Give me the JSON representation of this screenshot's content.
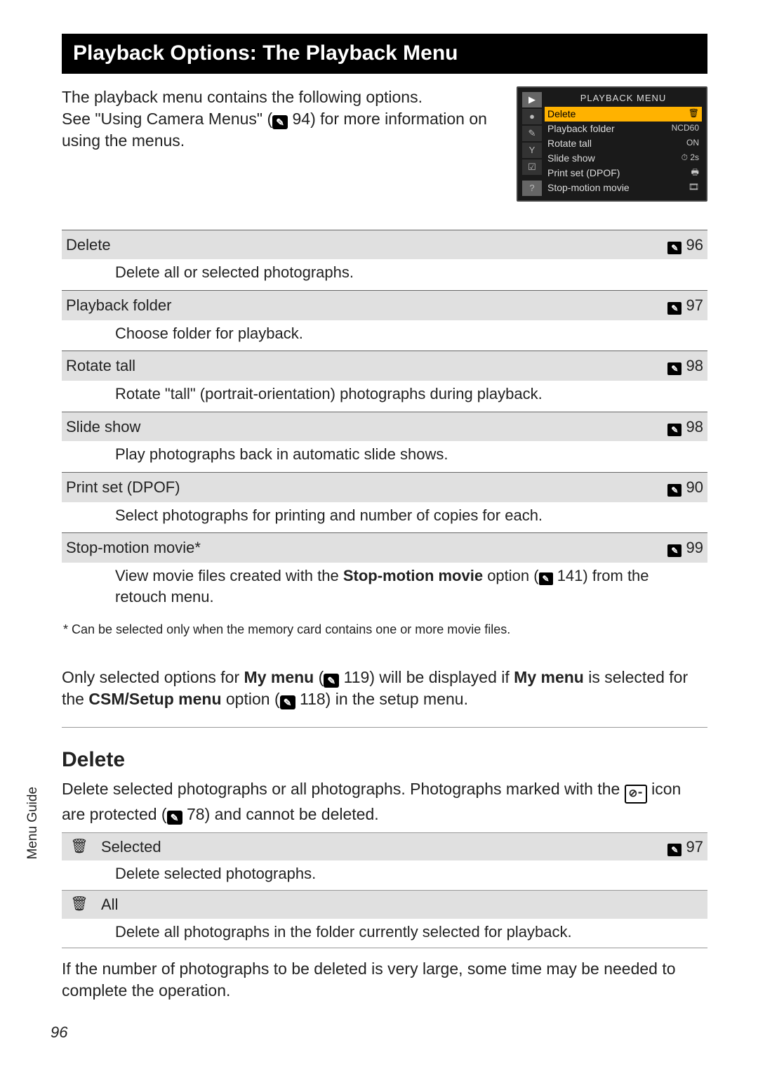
{
  "titleBar": "Playback Options: The Playback Menu",
  "intro": {
    "line1": "The playback menu contains the following options.",
    "line2a": "See \"Using Camera Menus\" (",
    "line2_ref": " 94",
    "line2b": ") for more information on using the menus."
  },
  "lcd": {
    "title": "PLAYBACK MENU",
    "items": [
      {
        "label": "Delete",
        "value": "🗑",
        "hl": true
      },
      {
        "label": "Playback folder",
        "value": "NCD60"
      },
      {
        "label": "Rotate tall",
        "value": "ON"
      },
      {
        "label": "Slide show",
        "value": "⏱ 2s"
      },
      {
        "label": "Print set (DPOF)",
        "value": "🖶"
      },
      {
        "label": "Stop-motion movie",
        "value": "🎞"
      }
    ],
    "tabs": [
      "▶",
      "●",
      "✎",
      "Y",
      "☑"
    ],
    "help": "?"
  },
  "options": [
    {
      "name": "Delete",
      "ref": "96",
      "desc": "Delete all or selected photographs."
    },
    {
      "name": "Playback folder",
      "ref": "97",
      "desc": "Choose folder for playback."
    },
    {
      "name": "Rotate tall",
      "ref": "98",
      "desc": "Rotate \"tall\" (portrait-orientation) photographs during playback."
    },
    {
      "name": "Slide show",
      "ref": "98",
      "desc": "Play photographs back in automatic slide shows."
    },
    {
      "name": "Print set (DPOF)",
      "ref": "90",
      "desc": "Select photographs for printing and number of copies for each."
    },
    {
      "name": "Stop-motion movie*",
      "ref": "99",
      "desc_pre": "View movie files created with the ",
      "desc_bold": "Stop-motion movie",
      "desc_mid": " option (",
      "desc_ref": " 141",
      "desc_post": ") from the retouch menu."
    }
  ],
  "footnote": "*  Can be selected only when the memory card contains one or more movie files.",
  "mymenu": {
    "pre": "Only selected options for ",
    "b1": "My menu",
    "mid1": " (",
    "ref1": " 119",
    "mid2": ") will be displayed if ",
    "b2": "My menu",
    "mid3": " is selected for the ",
    "b3": "CSM/Setup menu",
    "mid4": " option (",
    "ref2": " 118",
    "post": ") in the setup menu."
  },
  "delete": {
    "heading": "Delete",
    "intro_pre": "Delete selected photographs or all photographs. Photographs marked with the ",
    "intro_icon": "⊘⁃",
    "intro_mid": " icon are protected (",
    "intro_ref": " 78",
    "intro_post": ") and cannot be deleted.",
    "rows": [
      {
        "icon": "🗑",
        "name": "Selected",
        "ref": "97",
        "desc": "Delete selected photographs."
      },
      {
        "icon": "🗑",
        "name": "All",
        "ref": "",
        "desc": "Delete all photographs in the folder currently selected for playback."
      }
    ],
    "note": "If the number of photographs to be deleted is very large, some time may be needed to complete the operation."
  },
  "sideTab": "Menu Guide",
  "pageNum": "96"
}
